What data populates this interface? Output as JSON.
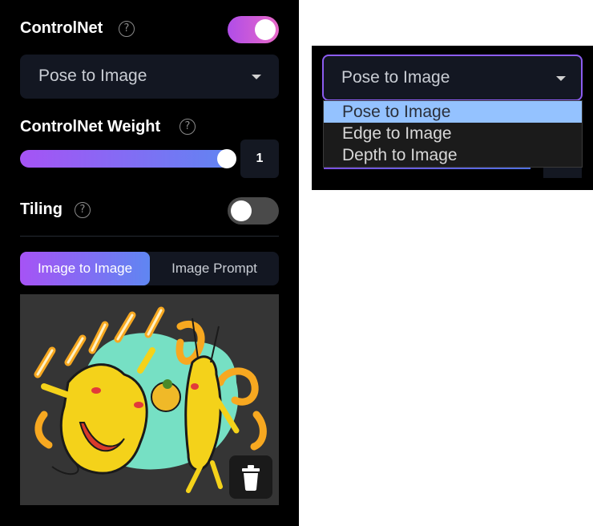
{
  "controlnet": {
    "title": "ControlNet",
    "help_glyph": "?",
    "enabled": true,
    "mode_value": "Pose to Image"
  },
  "weight": {
    "title": "ControlNet Weight",
    "help_glyph": "?",
    "value": "1",
    "slider_fraction": 1
  },
  "tiling": {
    "title": "Tiling",
    "help_glyph": "?",
    "enabled": false
  },
  "tabs": [
    {
      "label": "Image to Image",
      "active": true
    },
    {
      "label": "Image Prompt",
      "active": false
    }
  ],
  "image": {
    "alt_icon": "trash-icon"
  },
  "dropdown_popup": {
    "value": "Pose to Image",
    "options": [
      "Pose to Image",
      "Edge to Image",
      "Depth to Image"
    ],
    "highlighted_index": 0
  },
  "colors": {
    "accent_start": "#a653f5",
    "accent_end": "#5f86f2",
    "panel_bg": "#000000",
    "field_bg": "#131722",
    "option_highlight": "#94c2ff"
  }
}
